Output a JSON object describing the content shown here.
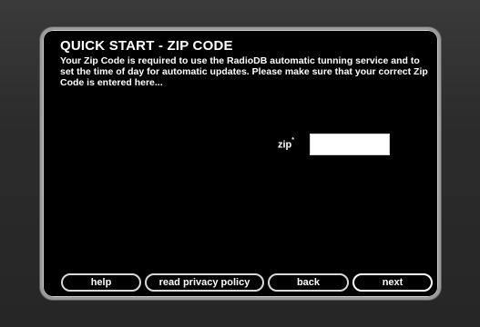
{
  "dialog": {
    "title": "QUICK START - ZIP CODE",
    "description": "Your Zip Code is required to use the RadioDB automatic tunning service and to set the time of day for automatic updates. Please make sure that your correct Zip Code is entered here...",
    "zip": {
      "label": "zip",
      "required_mark": "*",
      "value": ""
    }
  },
  "buttons": {
    "help": "help",
    "privacy": "read privacy policy",
    "back": "back",
    "next": "next"
  }
}
